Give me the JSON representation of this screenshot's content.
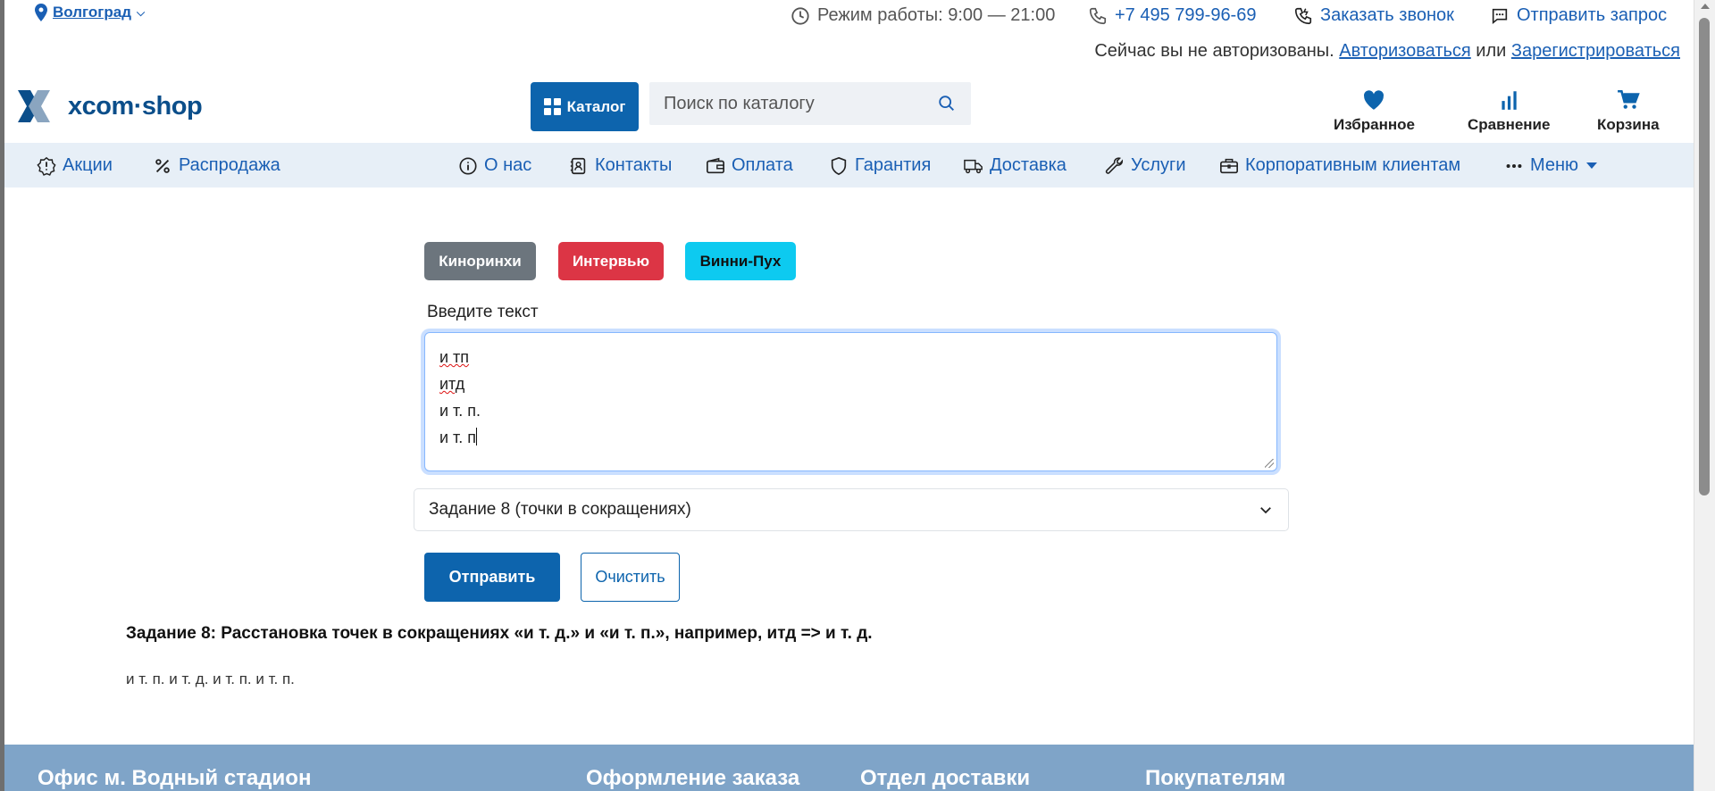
{
  "topbar": {
    "city": "Волгоград",
    "hours": "Режим работы: 9:00 — 21:00",
    "phone": "+7 495 799-96-69",
    "callback": "Заказать звонок",
    "request": "Отправить запрос",
    "auth_text": "Сейчас вы не авторизованы.",
    "auth_login": "Авторизоваться",
    "auth_or": "или",
    "auth_register": "Зарегистрироваться"
  },
  "header": {
    "logo": "xcom·shop",
    "catalog_label": "Каталог",
    "search_placeholder": "Поиск по каталогу",
    "favorites": "Избранное",
    "compare": "Сравнение",
    "cart": "Корзина"
  },
  "nav": {
    "items": [
      {
        "label": "Акции",
        "icon": "alert-icon"
      },
      {
        "label": "Распродажа",
        "icon": "percent-icon"
      },
      {
        "label": "О нас",
        "icon": "info-icon"
      },
      {
        "label": "Контакты",
        "icon": "contacts-icon"
      },
      {
        "label": "Оплата",
        "icon": "wallet-icon"
      },
      {
        "label": "Гарантия",
        "icon": "shield-icon"
      },
      {
        "label": "Доставка",
        "icon": "truck-icon"
      },
      {
        "label": "Услуги",
        "icon": "wrench-icon"
      },
      {
        "label": "Корпоративным клиентам",
        "icon": "briefcase-icon"
      },
      {
        "label": "Меню",
        "icon": "more-icon"
      }
    ]
  },
  "content": {
    "presets": [
      "Кинорин­хи",
      "Интервью",
      "Винни-Пух"
    ],
    "text_label": "Введите текст",
    "text_lines": [
      "и тп",
      "итд",
      "и т. п.",
      "и т. п"
    ],
    "select_value": "Задание 8 (точки в сокращениях)",
    "submit_label": "Отправить",
    "clear_label": "Очистить",
    "task_description": "Задание 8: Расстановка точек в сокращениях «и т. д.» и «и т. п.», например, итд => и т. д.",
    "result": "и т. п. и т. д. и т. п. и т. п."
  },
  "footer": {
    "columns": [
      "Офис м. Водный стадион",
      "Оформление заказа",
      "Отдел доставки",
      "Покупателям"
    ]
  },
  "colors": {
    "primary": "#0d64ad",
    "link": "#1a5fb4",
    "nav_bg": "#e7eff7",
    "danger": "#dc3545",
    "info": "#0dcaf0",
    "secondary": "#6c757d",
    "footer_bg": "#7fa4c8"
  }
}
